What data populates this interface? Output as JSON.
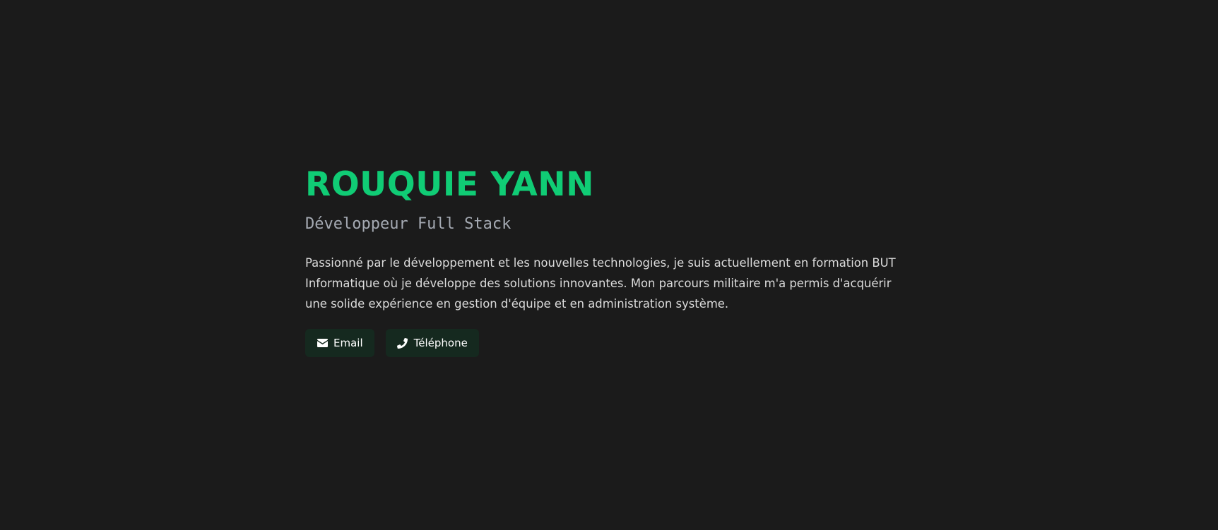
{
  "profile": {
    "name": "ROUQUIE YANN",
    "role": "Développeur Full Stack",
    "bio": "Passionné par le développement et les nouvelles technologies, je suis actuellement en formation BUT Informatique où je développe des solutions innovantes. Mon parcours militaire m'a permis d'acquérir une solide expérience en gestion d'équipe et en administration système."
  },
  "contact": {
    "email_label": "Email",
    "email_icon": "envelope-icon",
    "phone_label": "Téléphone",
    "phone_icon": "phone-icon"
  },
  "theme": {
    "background": "#1b1b1b",
    "accent": "#10cc75",
    "button_bg": "#15291f",
    "muted_text": "#a5aab3"
  }
}
